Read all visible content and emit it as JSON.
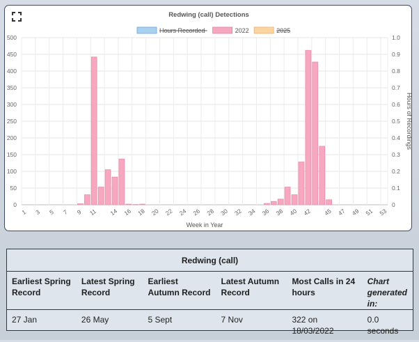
{
  "chart_data": {
    "type": "bar",
    "title": "Redwing (call) Detections",
    "xlabel": "Week in Year",
    "ylabel_right": "Hours of Recordings",
    "legend_position": "top",
    "legend": [
      {
        "name": "Hours Recorded",
        "color": "#a8d0f0",
        "stroke": "#6aa8e0",
        "struck": true
      },
      {
        "name": "2022",
        "color": "#f7a8c0",
        "stroke": "#e87ea0",
        "struck": false
      },
      {
        "name": "2025",
        "color": "#fcd4a0",
        "stroke": "#f0b060",
        "struck": true
      }
    ],
    "x": [
      1,
      2,
      3,
      4,
      5,
      6,
      7,
      8,
      9,
      10,
      11,
      12,
      13,
      14,
      15,
      16,
      17,
      18,
      19,
      20,
      21,
      22,
      23,
      24,
      25,
      26,
      27,
      28,
      29,
      30,
      31,
      32,
      33,
      34,
      35,
      36,
      37,
      38,
      39,
      40,
      41,
      42,
      43,
      44,
      45,
      46,
      47,
      48,
      49,
      50,
      51,
      52,
      53
    ],
    "x_tick_labels": [
      "1",
      "3",
      "5",
      "7",
      "9",
      "11",
      "14",
      "16",
      "18",
      "20",
      "22",
      "24",
      "26",
      "28",
      "30",
      "32",
      "34",
      "36",
      "38",
      "40",
      "42",
      "45",
      "47",
      "49",
      "51",
      "53"
    ],
    "series": [
      {
        "name": "2022",
        "color": "#f7a8c0",
        "values": [
          0,
          0,
          0,
          0,
          0,
          0,
          0,
          0,
          3,
          30,
          442,
          53,
          105,
          83,
          137,
          2,
          1,
          2,
          0,
          0,
          0,
          0,
          0,
          0,
          0,
          0,
          0,
          0,
          0,
          0,
          0,
          0,
          0,
          0,
          0,
          4,
          10,
          17,
          53,
          30,
          128,
          462,
          427,
          175,
          15,
          0,
          0,
          0,
          0,
          0,
          0,
          0,
          0
        ]
      }
    ],
    "y_left": {
      "min": 0,
      "max": 500,
      "ticks": [
        0,
        50,
        100,
        150,
        200,
        250,
        300,
        350,
        400,
        450,
        500
      ]
    },
    "y_right": {
      "min": 0,
      "max": 1,
      "tick_labels": [
        "0",
        "0.1",
        "0.2",
        "0.3",
        "0.4",
        "0.5",
        "0.6",
        "0.7",
        "0.8",
        "0.9",
        "1.0"
      ]
    },
    "grid": true
  },
  "table": {
    "title": "Redwing (call)",
    "headers": [
      "Earliest Spring Record",
      "Latest Spring Record",
      "Earliest Autumn Record",
      "Latest Autumn Record",
      "Most Calls in 24 hours",
      "Chart generated in:"
    ],
    "values": [
      "27 Jan",
      "26 May",
      "5 Sept",
      "7 Nov",
      "322 on 18/03/2022",
      "0.0 seconds"
    ]
  },
  "icons": {
    "expand": "expand-icon"
  }
}
